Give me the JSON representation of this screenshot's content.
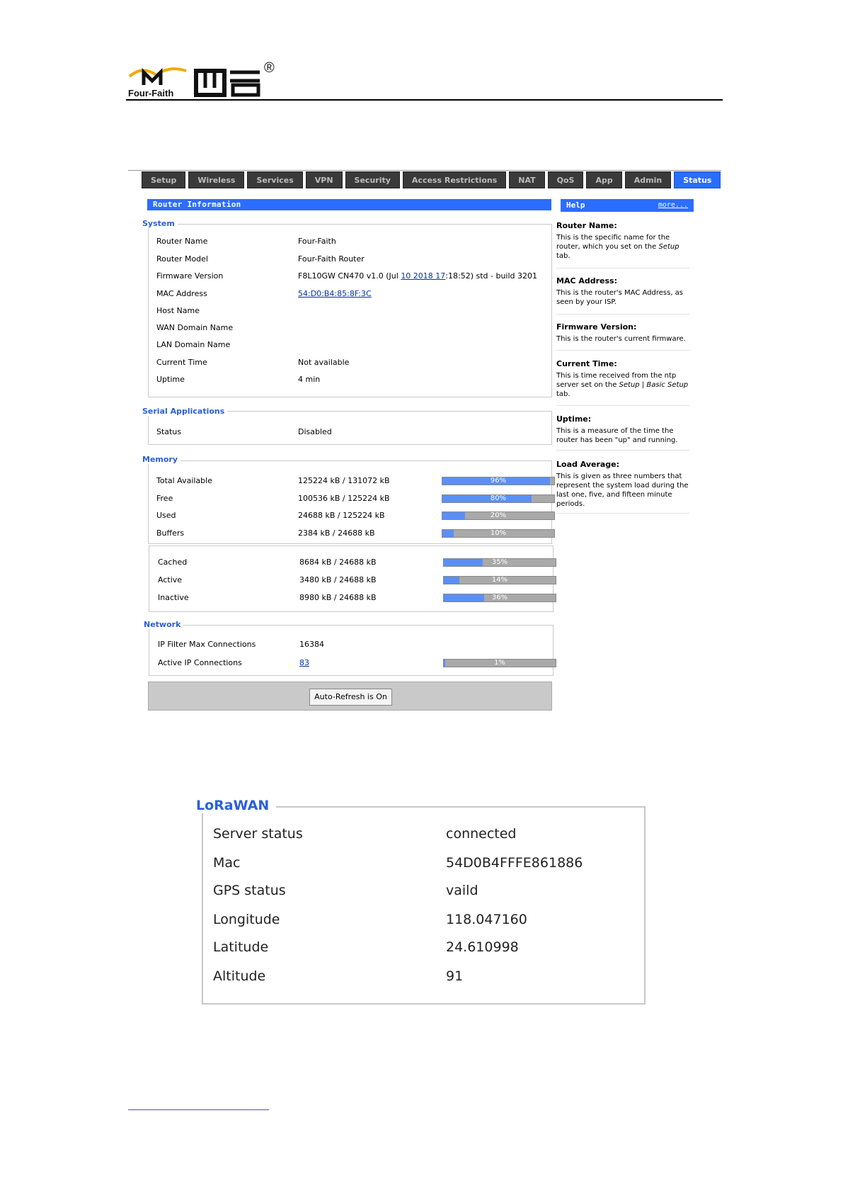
{
  "header": {
    "brand_text": "Four-Faith",
    "registered_mark": "®"
  },
  "nav": {
    "tabs": [
      {
        "label": "Setup"
      },
      {
        "label": "Wireless"
      },
      {
        "label": "Services"
      },
      {
        "label": "VPN"
      },
      {
        "label": "Security"
      },
      {
        "label": "Access Restrictions"
      },
      {
        "label": "NAT"
      },
      {
        "label": "QoS"
      },
      {
        "label": "App"
      },
      {
        "label": "Admin"
      },
      {
        "label": "Status",
        "active": true
      }
    ]
  },
  "router_info": {
    "title": "Router Information",
    "system": {
      "legend": "System",
      "rows": [
        {
          "label": "Router Name",
          "value": "Four-Faith"
        },
        {
          "label": "Router Model",
          "value": "Four-Faith Router"
        },
        {
          "label": "Firmware Version",
          "value_pre": "F8L10GW CN470 v1.0 (Jul ",
          "value_link": "10 2018 17",
          "value_post": ":18:52) std - build 3201"
        },
        {
          "label": "MAC Address",
          "value": "54:D0:B4:85:8F:3C"
        },
        {
          "label": "Host Name",
          "value": ""
        },
        {
          "label": "WAN Domain Name",
          "value": ""
        },
        {
          "label": "LAN Domain Name",
          "value": ""
        },
        {
          "label": "Current Time",
          "value": "Not available"
        },
        {
          "label": "Uptime",
          "value": "4 min"
        }
      ]
    },
    "serial": {
      "legend": "Serial Applications",
      "rows": [
        {
          "label": "Status",
          "value": "Disabled"
        }
      ]
    },
    "memory": {
      "legend": "Memory",
      "rows": [
        {
          "label": "Total Available",
          "value": "125224 kB / 131072 kB",
          "percent": 96,
          "percent_label": "96%"
        },
        {
          "label": "Free",
          "value": "100536 kB / 125224 kB",
          "percent": 80,
          "percent_label": "80%"
        },
        {
          "label": "Used",
          "value": "24688 kB / 125224 kB",
          "percent": 20,
          "percent_label": "20%"
        },
        {
          "label": "Buffers",
          "value": "2384 kB / 24688 kB",
          "percent": 10,
          "percent_label": "10%"
        }
      ],
      "rows2": [
        {
          "label": "Cached",
          "value": "8684 kB / 24688 kB",
          "percent": 35,
          "percent_label": "35%"
        },
        {
          "label": "Active",
          "value": "3480 kB / 24688 kB",
          "percent": 14,
          "percent_label": "14%"
        },
        {
          "label": "Inactive",
          "value": "8980 kB / 24688 kB",
          "percent": 36,
          "percent_label": "36%"
        }
      ]
    },
    "network": {
      "legend": "Network",
      "rows": [
        {
          "label": "IP Filter Max Connections",
          "value": "16384"
        },
        {
          "label": "Active IP Connections",
          "value": "83",
          "percent": 1,
          "percent_label": "1%"
        }
      ]
    },
    "auto_refresh_label": "Auto-Refresh is On"
  },
  "help": {
    "title": "Help",
    "more": "more...",
    "items": [
      {
        "heading": "Router Name:",
        "text": "This is the specific name for the router, which you set on the ",
        "em": "Setup",
        "text2": " tab."
      },
      {
        "heading": "MAC Address:",
        "text": "This is the router's MAC Address, as seen by your ISP."
      },
      {
        "heading": "Firmware Version:",
        "text": "This is the router's current firmware."
      },
      {
        "heading": "Current Time:",
        "text": "This is time received from the ntp server set on the ",
        "em": "Setup | Basic Setup",
        "text2": " tab."
      },
      {
        "heading": "Uptime:",
        "text": "This is a measure of the time the router has been \"up\" and running."
      },
      {
        "heading": "Load Average:",
        "text": "This is given as three numbers that represent the system load during the last one, five, and fifteen minute periods."
      }
    ]
  },
  "lorawan": {
    "legend": "LoRaWAN",
    "rows": [
      {
        "label": "Server status",
        "value": "connected"
      },
      {
        "label": "Mac",
        "value": "54D0B4FFFE861886"
      },
      {
        "label": "GPS status",
        "value": "vaild"
      },
      {
        "label": "Longitude",
        "value": "118.047160"
      },
      {
        "label": "Latitude",
        "value": "24.610998"
      },
      {
        "label": "Altitude",
        "value": "91"
      }
    ]
  },
  "colors": {
    "accent": "#2b6dff",
    "legend": "#2b5fd9",
    "bar_fill": "#5b8ff5",
    "bar_bg": "#a9a9a9",
    "tab_bg": "#3a3a3a"
  }
}
